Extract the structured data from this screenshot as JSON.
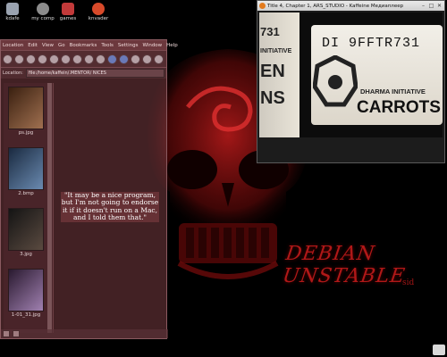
{
  "desktop_icons": [
    {
      "label": "kdafe",
      "icon": "home-folder-icon",
      "color": "#9aa3b0"
    },
    {
      "label": "my comp",
      "icon": "computer-icon",
      "color": "#8c8c8c"
    },
    {
      "label": "games",
      "icon": "games-icon",
      "color": "#c23a3a"
    },
    {
      "label": "knvader",
      "icon": "knvader-icon",
      "color": "#d84a2a"
    }
  ],
  "file_manager": {
    "menu": [
      "Location",
      "Edit",
      "View",
      "Go",
      "Bookmarks",
      "Tools",
      "Settings",
      "Window",
      "Help"
    ],
    "location_label": "Location:",
    "location_value": "file:/home/kaffein/.MENTOR/ NICES",
    "thumbnails": [
      {
        "caption": "ps.jpg",
        "color_a": "#3a2010",
        "color_b": "#a07050"
      },
      {
        "caption": "2.bmp",
        "color_a": "#1a2a40",
        "color_b": "#6a8ab0"
      },
      {
        "caption": "3.jpg",
        "color_a": "#141414",
        "color_b": "#5a4a40"
      },
      {
        "caption": "1-01_31.jpg",
        "color_a": "#2a1a30",
        "color_b": "#a080b0"
      }
    ]
  },
  "quote": "\"It may be a nice program, but I'm not going to endorse it if it doesn't run on a Mac, and I told them that.\"",
  "player": {
    "title": "Title 4, Chapter 1, ARS_STUDIO - Kaffeine Медиаплеер",
    "scene": {
      "left_fragments": [
        "731",
        "INITIATIVE",
        "EN",
        "NS"
      ],
      "barcode": "DI 9FFTR731",
      "dharma": "DHARMA INITIATIVE",
      "carrots": "CARROTS"
    }
  },
  "wallpaper": {
    "text": "DEBIAN UNSTABLE",
    "sub": "sid",
    "accent": "#b01818"
  }
}
